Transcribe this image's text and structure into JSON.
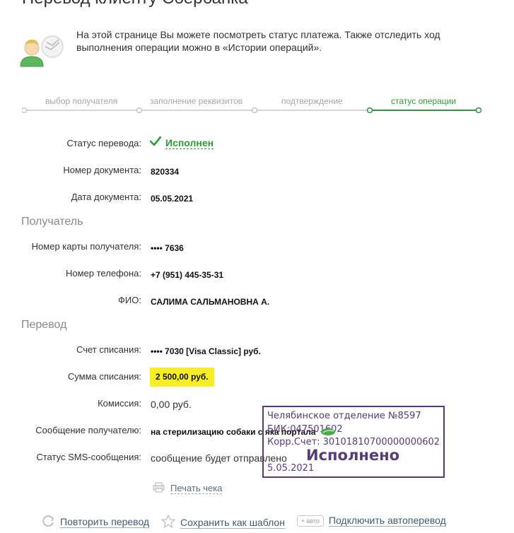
{
  "page": {
    "title": "Перевод клиенту Сбербанка",
    "intro": "На этой странице Вы можете посмотреть статус платежа. Также отследить ход выполнения операции можно в «Истории операций»."
  },
  "steps": [
    {
      "label": "выбор получателя",
      "active": false
    },
    {
      "label": "заполнение реквизитов",
      "active": false
    },
    {
      "label": "подтверждение",
      "active": false
    },
    {
      "label": "статус операции",
      "active": true
    }
  ],
  "details": {
    "status_label": "Статус перевода:",
    "status_value": "Исполнен",
    "doc_number_label": "Номер документа:",
    "doc_number_value": "820334",
    "doc_date_label": "Дата документа:",
    "doc_date_value": "05.05.2021"
  },
  "recipient": {
    "section_title": "Получатель",
    "card_label": "Номер карты получателя:",
    "card_value": "•••• 7636",
    "phone_label": "Номер телефона:",
    "phone_value": "+7 (951) 445-35-31",
    "name_label": "ФИО:",
    "name_value": "САЛИМА САЛЬМАНОВНА А."
  },
  "transfer": {
    "section_title": "Перевод",
    "account_label": "Счет списания:",
    "account_value": "•••• 7030  [Visa Classic]  руб.",
    "amount_label": "Сумма списания:",
    "amount_value": "2 500,00  руб.",
    "fee_label": "Комиссия:",
    "fee_value": "0,00 руб.",
    "message_label": "Сообщение получателю:",
    "message_value": "на стерилизацию собаки с яка портала",
    "sms_label": "Статус SMS-сообщения:",
    "sms_value": "сообщение будет отправлено"
  },
  "stamp": {
    "line1": "Челябинское отделение №8597",
    "line2": "БИК:047501602",
    "line3": "Корр.Счет: 30101810700000000602",
    "line4": "5.05.2021",
    "big": "Исполнено"
  },
  "print": {
    "label": "Печать чека"
  },
  "actions": {
    "repeat": "Повторить перевод",
    "save_template": "Сохранить как шаблон",
    "auto_badge": "авто",
    "autotransfer": "Подключить автоперевод"
  },
  "colors": {
    "accent_green": "#2d9b33",
    "amount_highlight": "#f7ee26",
    "stamp": "#5a3b7a"
  }
}
